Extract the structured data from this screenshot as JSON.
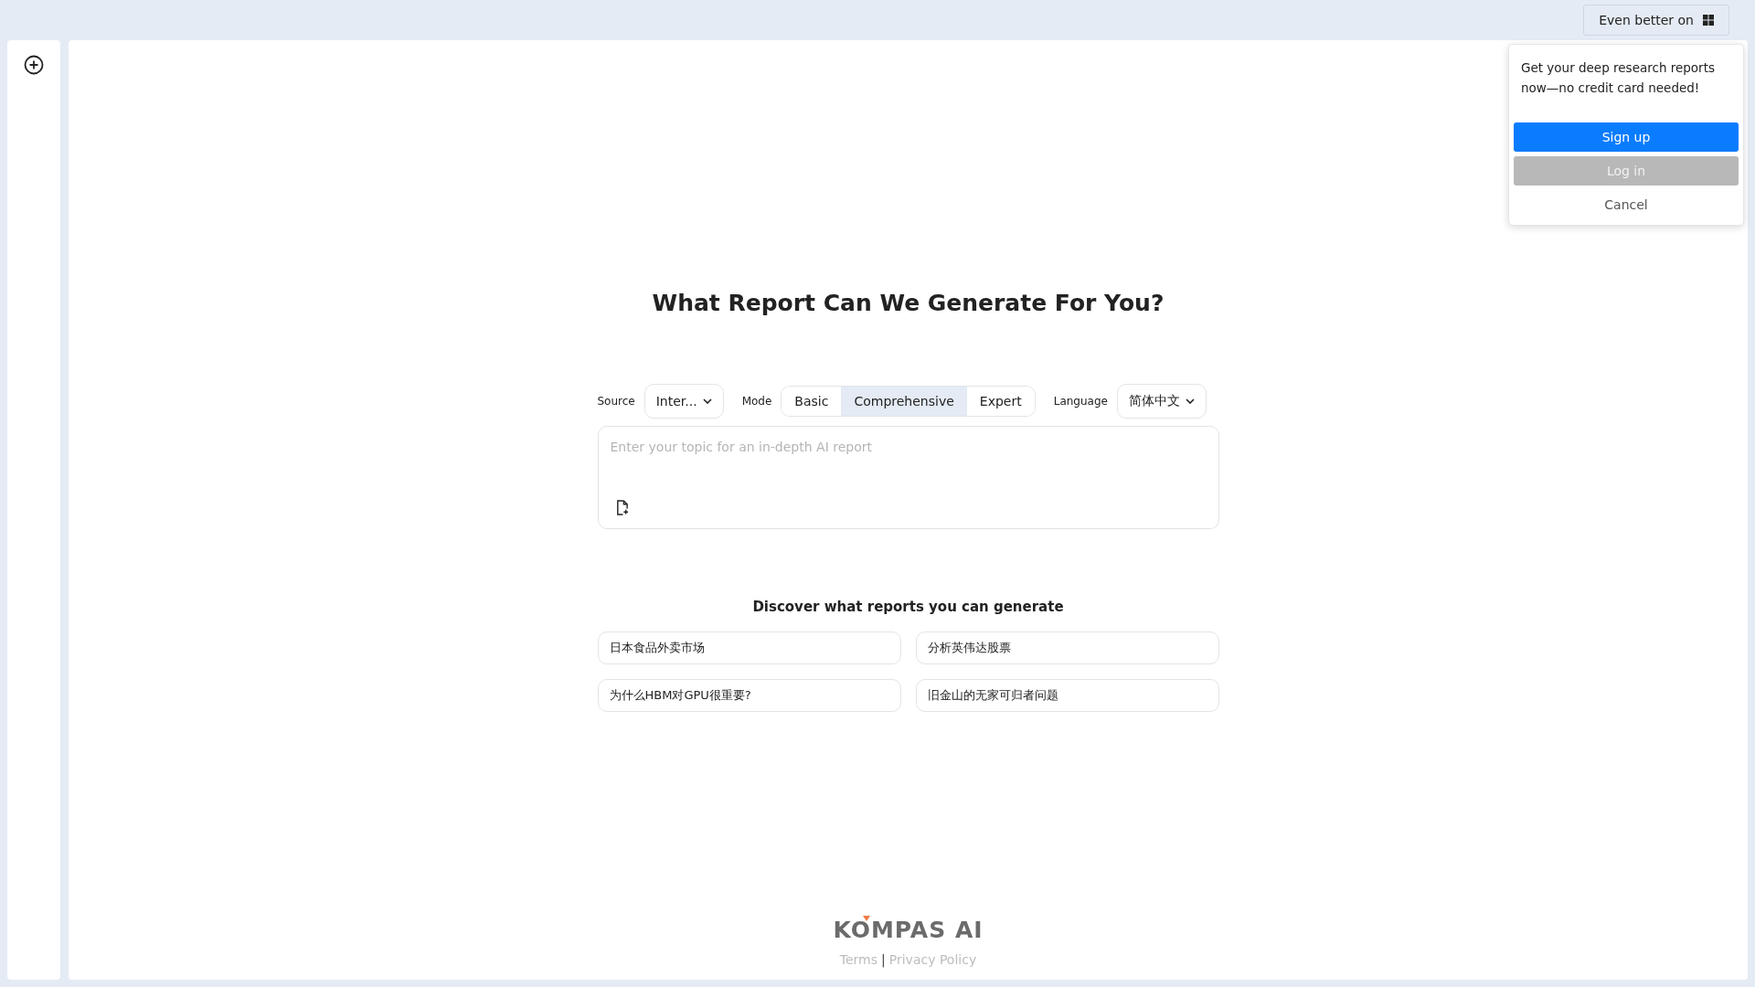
{
  "top_bar": {
    "platform_button": "Even better on"
  },
  "heading": "What Report Can We Generate For You?",
  "source": {
    "label": "Source",
    "value": "Inter..."
  },
  "mode": {
    "label": "Mode",
    "options": [
      {
        "label": "Basic",
        "selected": false
      },
      {
        "label": "Comprehensive",
        "selected": true
      },
      {
        "label": "Expert",
        "selected": false
      }
    ]
  },
  "language": {
    "label": "Language",
    "value": "简体中文"
  },
  "topic_input": {
    "placeholder": "Enter your topic for an in-depth AI report"
  },
  "discover": {
    "title": "Discover what reports you can generate",
    "suggestions": [
      "日本食品外卖市场",
      "分析英伟达股票",
      "为什么HBM对GPU很重要?",
      "旧金山的无家可归者问题"
    ]
  },
  "footer": {
    "logo": "KOMPAS AI",
    "links": [
      "Terms",
      "Privacy Policy"
    ],
    "separator": "|"
  },
  "signup_popup": {
    "message": "Get your deep research reports now—no credit card needed!",
    "buttons": [
      {
        "label": "Sign up",
        "kind": "primary"
      },
      {
        "label": "Log in",
        "kind": "secondary"
      },
      {
        "label": "Cancel",
        "kind": "plain"
      }
    ]
  }
}
